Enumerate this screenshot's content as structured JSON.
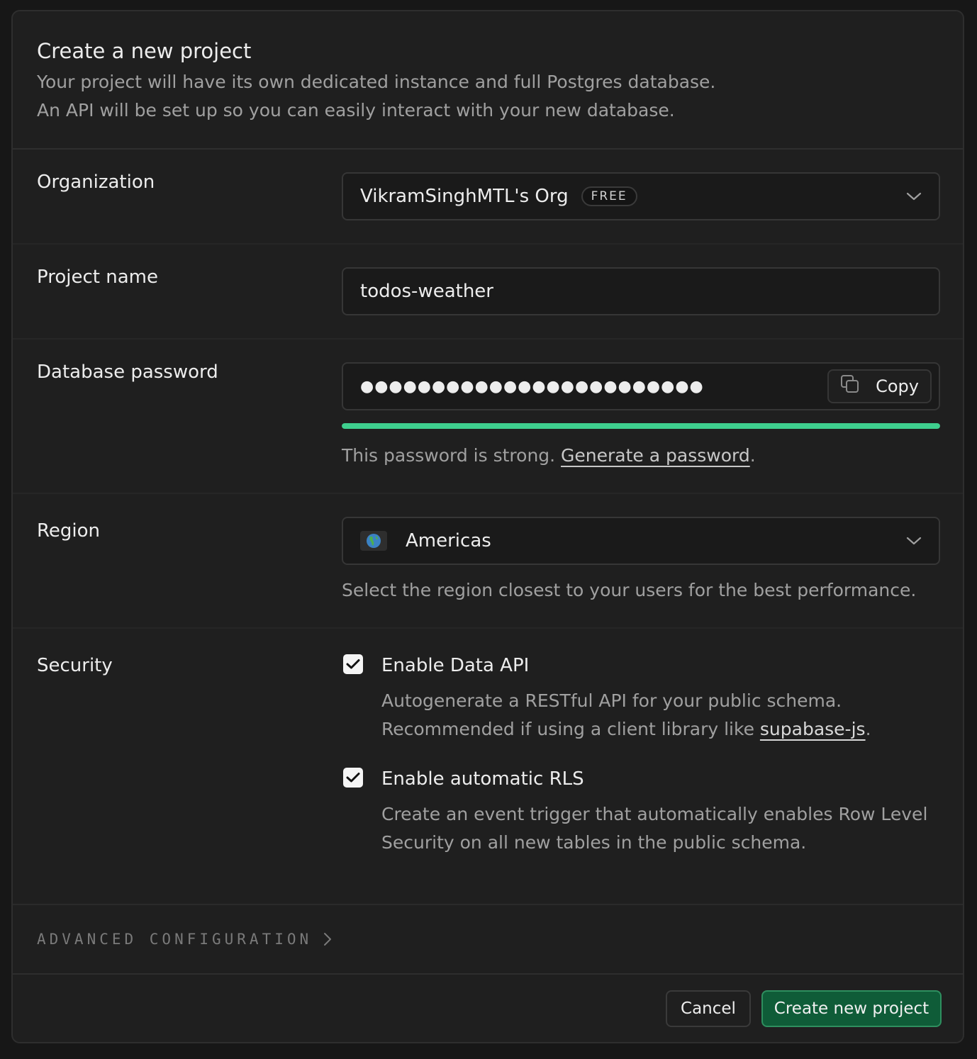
{
  "header": {
    "title": "Create a new project",
    "description_line1": "Your project will have its own dedicated instance and full Postgres database.",
    "description_line2": "An API will be set up so you can easily interact with your new database."
  },
  "organization": {
    "label": "Organization",
    "value": "VikramSinghMTL's Org",
    "badge": "FREE"
  },
  "project_name": {
    "label": "Project name",
    "value": "todos-weather"
  },
  "database_password": {
    "label": "Database password",
    "masked_value": "●●●●●●●●●●●●●●●●●●●●●●●●",
    "copy_label": "Copy",
    "strength_fraction": 1.0,
    "strength_color": "#3ecf8e",
    "hint_prefix": "This password is strong. ",
    "generate_link": "Generate a password",
    "hint_suffix": "."
  },
  "region": {
    "label": "Region",
    "value": "Americas",
    "icon": "globe-americas-icon",
    "hint": "Select the region closest to your users for the best performance."
  },
  "security": {
    "label": "Security",
    "options": [
      {
        "title": "Enable Data API",
        "checked": true,
        "desc_line1": "Autogenerate a RESTful API for your public schema.",
        "desc_line2_prefix": "Recommended if using a client library like ",
        "desc_link": "supabase-js",
        "desc_line2_suffix": "."
      },
      {
        "title": "Enable automatic RLS",
        "checked": true,
        "desc_line1": "Create an event trigger that automatically enables Row Level",
        "desc_line2": "Security on all new tables in the public schema."
      }
    ]
  },
  "advanced": {
    "label": "ADVANCED CONFIGURATION"
  },
  "footer": {
    "cancel_label": "Cancel",
    "create_label": "Create new project"
  },
  "colors": {
    "accent_green": "#3ecf8e",
    "create_button_bg": "#0f5c38",
    "background": "#1f1f1f"
  }
}
